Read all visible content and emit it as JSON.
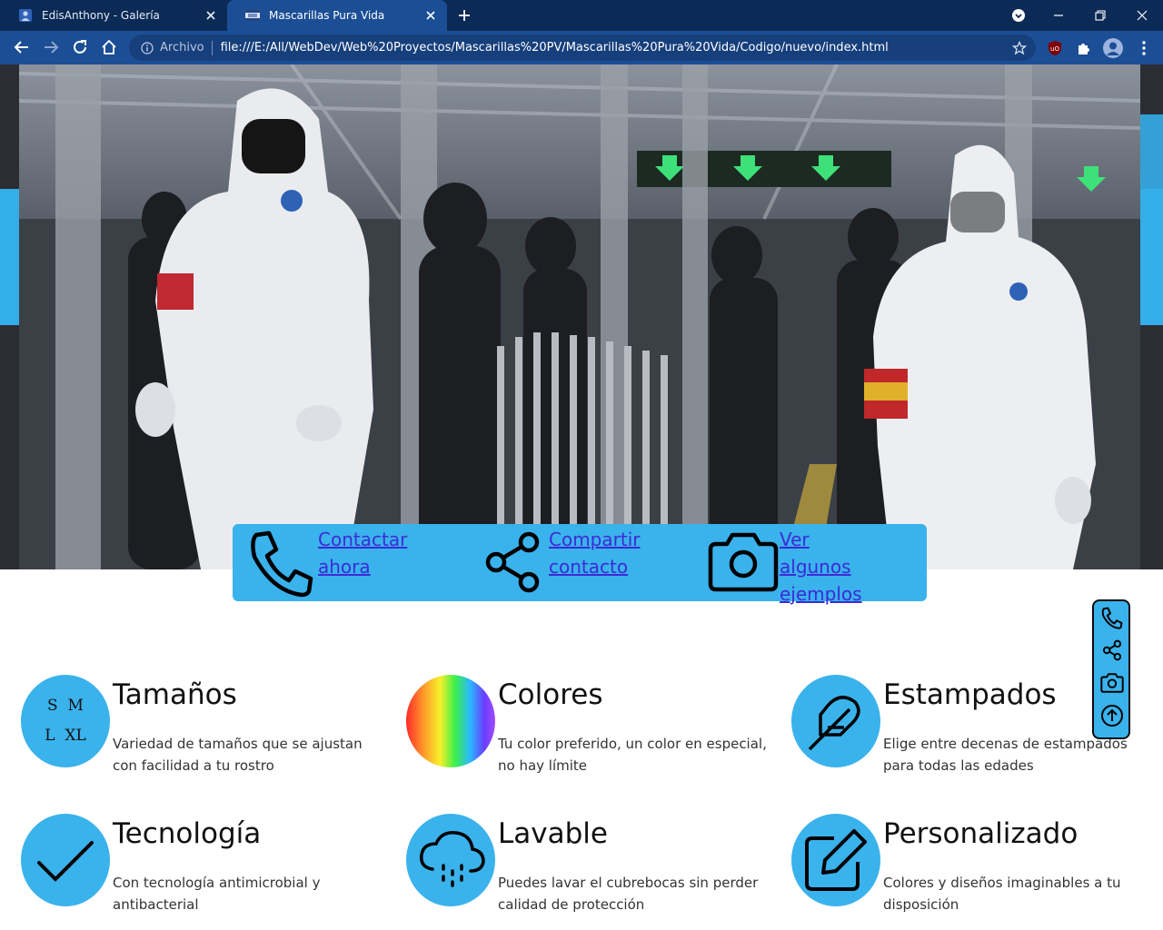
{
  "browser": {
    "tabs": [
      {
        "title": "EdisAnthony - Galería",
        "active": false,
        "favicon": "profile-icon"
      },
      {
        "title": "Mascarillas Pura Vida",
        "active": true,
        "favicon": "site-favicon-icon"
      }
    ],
    "address": {
      "security_label": "Archivo",
      "url": "file:///E:/All/WebDev/Web%20Proyectos/Mascarillas%20PV/Mascarillas%20Pura%20Vida/Codigo/nuevo/index.html"
    },
    "colors": {
      "tabbar": "#0b2a55",
      "toolbar": "#1c4e96",
      "omnibox": "#163f7c"
    }
  },
  "page": {
    "accent": "#3ab2ec",
    "link_color": "#3b2bd6",
    "actions": [
      {
        "label": "Contactar ahora",
        "icon": "phone-icon"
      },
      {
        "label": "Compartir contacto",
        "icon": "share-icon"
      },
      {
        "label": "Ver algunos ejemplos",
        "icon": "camera-icon"
      }
    ],
    "floating_menu": [
      "phone-icon",
      "share-icon",
      "camera-icon",
      "arrow-up-circle-icon"
    ],
    "sizes_badge": [
      "S",
      "M",
      "L",
      "XL"
    ],
    "features": [
      {
        "title": "Tamaños",
        "text": "Variedad de tamaños que se ajustan con facilidad a tu rostro",
        "icon": "sizes-icon"
      },
      {
        "title": "Colores",
        "text": "Tu color preferido, un color en especial, no hay límite",
        "icon": "rainbow-icon"
      },
      {
        "title": "Estampados",
        "text": "Elige entre decenas de estampados para todas las edades",
        "icon": "feather-icon"
      },
      {
        "title": "Tecnología",
        "text": "Con tecnología antimicrobial y antibacterial",
        "icon": "check-icon"
      },
      {
        "title": "Lavable",
        "text": "Puedes lavar el cubrebocas sin perder calidad de protección",
        "icon": "cloud-rain-icon"
      },
      {
        "title": "Personalizado",
        "text": "Colores y diseños imaginables a tu disposición",
        "icon": "edit-icon"
      }
    ]
  }
}
